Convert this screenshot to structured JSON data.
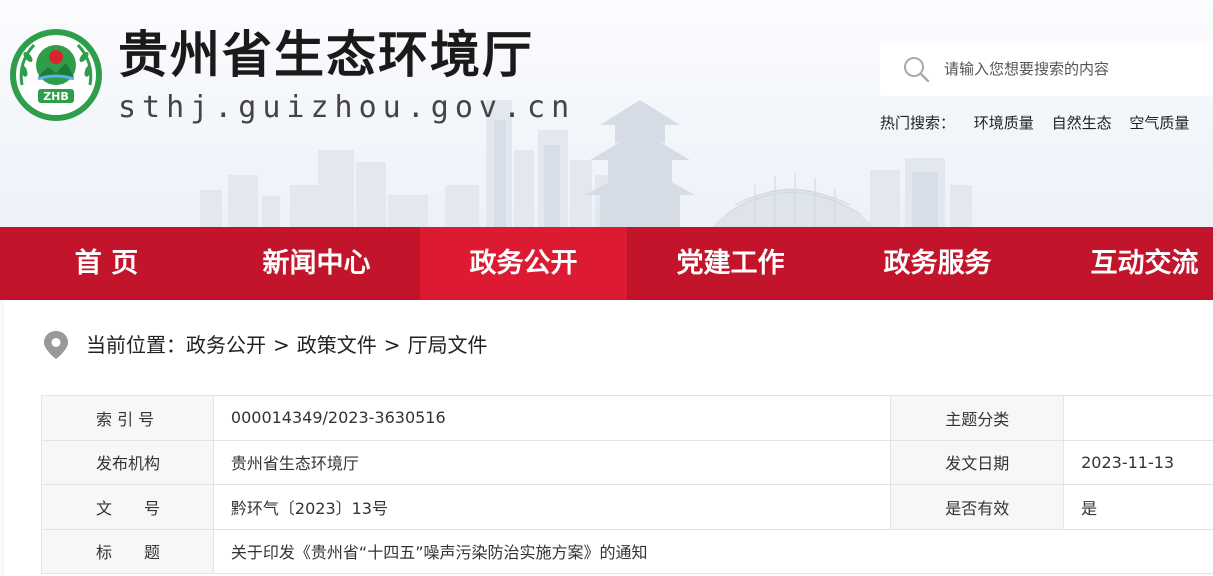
{
  "site": {
    "title": "贵州省生态环境厅",
    "domain": "sthj.guizhou.gov.cn",
    "logo_text": "ZHB"
  },
  "search": {
    "placeholder": "请输入您想要搜索的内容",
    "hot_label": "热门搜索：",
    "hot_items": [
      "环境质量",
      "自然生态",
      "空气质量"
    ]
  },
  "nav": {
    "items": [
      "首 页",
      "新闻中心",
      "政务公开",
      "党建工作",
      "政务服务",
      "互动交流"
    ],
    "active_index": 2
  },
  "breadcrumb": {
    "prefix": "当前位置：",
    "items": [
      "政务公开",
      "政策文件",
      "厅局文件"
    ],
    "separator": ">"
  },
  "info_table": {
    "rows": [
      {
        "label": "索 引 号",
        "value": "000014349/2023-3630516",
        "label2": "主题分类",
        "value2": ""
      },
      {
        "label": "发布机构",
        "value": "贵州省生态环境厅",
        "label2": "发文日期",
        "value2": "2023-11-13"
      },
      {
        "label": "文　　号",
        "value": "黔环气〔2023〕13号",
        "label2": "是否有效",
        "value2": "是"
      },
      {
        "label": "标　　题",
        "value": "关于印发《贵州省“十四五”噪声污染防治实施方案》的通知"
      }
    ]
  },
  "colors": {
    "nav_bg": "#c2142b",
    "nav_active": "#dc1a31",
    "logo_green": "#2e9e4a",
    "logo_red": "#d6262c"
  }
}
